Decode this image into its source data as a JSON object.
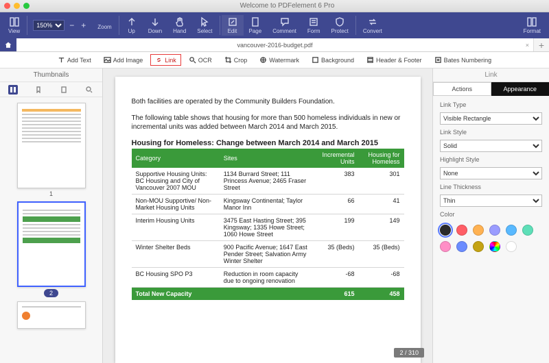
{
  "app": {
    "title": "Welcome to PDFelement 6 Pro"
  },
  "toolbar": {
    "view": "View",
    "zoom": "Zoom",
    "zoom_value": "150%",
    "up": "Up",
    "down": "Down",
    "hand": "Hand",
    "select": "Select",
    "edit": "Edit",
    "page": "Page",
    "comment": "Comment",
    "form": "Form",
    "protect": "Protect",
    "convert": "Convert",
    "format": "Format"
  },
  "tab": {
    "filename": "vancouver-2016-budget.pdf"
  },
  "subtoolbar": {
    "add_text": "Add Text",
    "add_image": "Add Image",
    "link": "Link",
    "ocr": "OCR",
    "crop": "Crop",
    "watermark": "Watermark",
    "background": "Background",
    "header_footer": "Header & Footer",
    "bates": "Bates Numbering"
  },
  "thumbnails": {
    "title": "Thumbnails",
    "page1": "1",
    "page2": "2"
  },
  "document": {
    "para1": "Both facilities are operated by the Community Builders Foundation.",
    "para2": "The following table shows that housing for more than 500 homeless individuals in new or incremental units was added between March 2014 and March 2015.",
    "table_title": "Housing for Homeless: Change between March 2014 and March 2015",
    "headers": {
      "category": "Category",
      "sites": "Sites",
      "incremental": "Incremental Units",
      "housing": "Housing for Homeless"
    },
    "rows": [
      {
        "category": "Supportive Housing Units: BC Housing and City of Vancouver 2007 MOU",
        "sites": "1134 Burrard Street; 111 Princess Avenue; 2465 Fraser Street",
        "inc": "383",
        "hh": "301"
      },
      {
        "category": "Non-MOU Supportive/ Non-Market Housing Units",
        "sites": "Kingsway Continental; Taylor Manor Inn",
        "inc": "66",
        "hh": "41"
      },
      {
        "category": "Interim Housing Units",
        "sites": "3475 East Hasting Street; 395 Kingsway; 1335 Howe Street; 1060 Howe Street",
        "inc": "199",
        "hh": "149"
      },
      {
        "category": "Winter Shelter Beds",
        "sites": "900 Pacific Avenue; 1647 East Pender Street; Salvation Army Winter Shelter",
        "inc": "35 (Beds)",
        "hh": "35 (Beds)"
      },
      {
        "category": "BC Housing SPO P3",
        "sites": "Reduction in room capacity due to ongoing renovation",
        "inc": "-68",
        "hh": "-68"
      }
    ],
    "total": {
      "label": "Total New Capacity",
      "inc": "615",
      "hh": "458"
    },
    "page_indicator": "2 / 310"
  },
  "rightpanel": {
    "title": "Link",
    "tab_actions": "Actions",
    "tab_appearance": "Appearance",
    "link_type_label": "Link Type",
    "link_type": "Visible Rectangle",
    "link_style_label": "Link Style",
    "link_style": "Solid",
    "highlight_label": "Highlight Style",
    "highlight": "None",
    "thickness_label": "Line Thickness",
    "thickness": "Thin",
    "color_label": "Color"
  },
  "colors": [
    "#2b2b2b",
    "#ff5e66",
    "#ffb252",
    "#9a9cff",
    "#59b9ff",
    "#5edfb8",
    "#ff8fc6",
    "#6b8cff",
    "#c4a313",
    "#dddddd",
    "#ffffff"
  ],
  "chart_data": {
    "type": "table",
    "title": "Housing for Homeless: Change between March 2014 and March 2015",
    "columns": [
      "Category",
      "Sites",
      "Incremental Units",
      "Housing for Homeless"
    ],
    "rows": [
      [
        "Supportive Housing Units: BC Housing and City of Vancouver 2007 MOU",
        "1134 Burrard Street; 111 Princess Avenue; 2465 Fraser Street",
        383,
        301
      ],
      [
        "Non-MOU Supportive/ Non-Market Housing Units",
        "Kingsway Continental; Taylor Manor Inn",
        66,
        41
      ],
      [
        "Interim Housing Units",
        "3475 East Hasting Street; 395 Kingsway; 1335 Howe Street; 1060 Howe Street",
        199,
        149
      ],
      [
        "Winter Shelter Beds",
        "900 Pacific Avenue; 1647 East Pender Street; Salvation Army Winter Shelter",
        "35 (Beds)",
        "35 (Beds)"
      ],
      [
        "BC Housing SPO P3",
        "Reduction in room capacity due to ongoing renovation",
        -68,
        -68
      ]
    ],
    "totals": [
      "Total New Capacity",
      "",
      615,
      458
    ]
  }
}
